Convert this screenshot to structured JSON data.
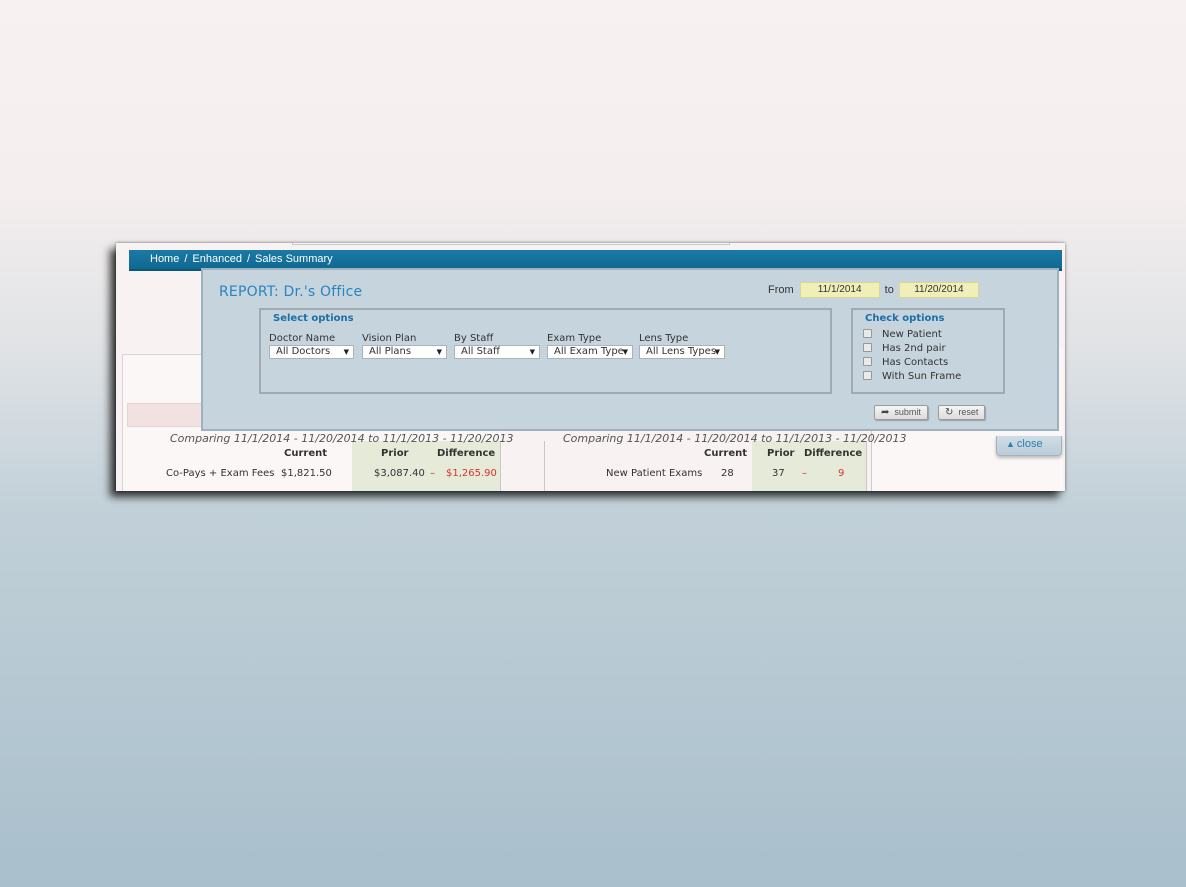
{
  "breadcrumb": {
    "items": [
      "Home",
      "Enhanced",
      "Sales Summary"
    ],
    "sep": "/"
  },
  "report": {
    "title": "REPORT: Dr.'s Office",
    "from_label": "From",
    "from_value": "11/1/2014",
    "to_label": "to",
    "to_value": "11/20/2014"
  },
  "select_options": {
    "legend": "Select options",
    "fields": [
      {
        "label": "Doctor Name",
        "value": "All Doctors"
      },
      {
        "label": "Vision Plan",
        "value": "All Plans"
      },
      {
        "label": "By Staff",
        "value": "All Staff"
      },
      {
        "label": "Exam Type",
        "value": "All Exam Type"
      },
      {
        "label": "Lens Type",
        "value": "All Lens Types"
      }
    ]
  },
  "check_options": {
    "legend": "Check options",
    "items": [
      "New Patient",
      "Has 2nd pair",
      "Has Contacts",
      "With Sun Frame"
    ]
  },
  "buttons": {
    "submit": "submit",
    "reset": "reset",
    "close": "close"
  },
  "background": {
    "compare_left": "Comparing 11/1/2014 - 11/20/2014 to 11/1/2013 - 11/20/2013",
    "compare_right": "Comparing 11/1/2014 - 11/20/2014 to 11/1/2013 - 11/20/2013",
    "headers": {
      "current": "Current",
      "prior": "Prior",
      "difference": "Difference"
    },
    "left_row": {
      "label": "Co-Pays + Exam Fees",
      "current": "$1,821.50",
      "prior": "$3,087.40",
      "sign": "–",
      "difference": "$1,265.90"
    },
    "right_row": {
      "label": "New Patient Exams",
      "current": "28",
      "prior": "37",
      "sign": "–",
      "difference": "9"
    }
  },
  "colors": {
    "navbar": "#1a7aa5",
    "report_title": "#2a84bf",
    "negative": "#d9342b",
    "date_field": "#f0efb9"
  }
}
